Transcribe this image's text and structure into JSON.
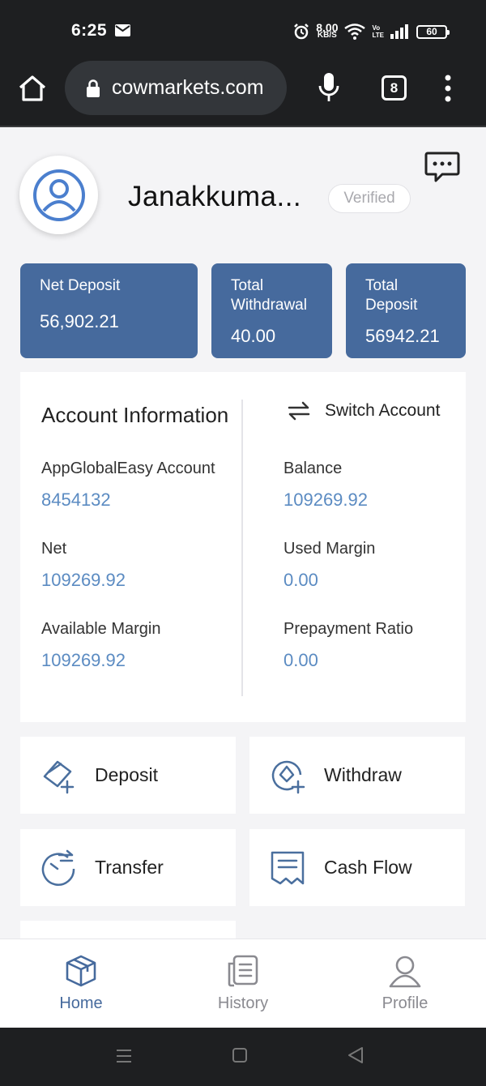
{
  "status_bar": {
    "time": "6:25",
    "net_speed_value": "8.00",
    "net_speed_unit": "KB/S",
    "network_type_top": "Vo",
    "network_type_bottom": "LTE",
    "battery_level": "60"
  },
  "browser": {
    "url": "cowmarkets.com",
    "tab_count": "8"
  },
  "profile": {
    "name": "Janakkuma...",
    "status_badge": "Verified"
  },
  "summary_cards": [
    {
      "label": "Net Deposit",
      "value": "56,902.21"
    },
    {
      "label": "Total Withdrawal",
      "value": "40.00"
    },
    {
      "label": "Total Deposit",
      "value": "56942.21"
    }
  ],
  "account_info": {
    "title": "Account Information",
    "switch_label": "Switch Account",
    "fields": [
      {
        "label": "AppGlobalEasy Account",
        "value": "8454132"
      },
      {
        "label": "Balance",
        "value": "109269.92"
      },
      {
        "label": "Net",
        "value": "109269.92"
      },
      {
        "label": "Used Margin",
        "value": "0.00"
      },
      {
        "label": "Available Margin",
        "value": "109269.92"
      },
      {
        "label": "Prepayment Ratio",
        "value": "0.00"
      }
    ]
  },
  "actions": [
    {
      "label": "Deposit",
      "icon": "deposit-card-icon"
    },
    {
      "label": "Withdraw",
      "icon": "withdraw-icon"
    },
    {
      "label": "Transfer",
      "icon": "transfer-icon"
    },
    {
      "label": "Cash Flow",
      "icon": "receipt-icon"
    }
  ],
  "bottom_nav": [
    {
      "label": "Home",
      "icon": "cube-icon",
      "active": true
    },
    {
      "label": "History",
      "icon": "document-icon",
      "active": false
    },
    {
      "label": "Profile",
      "icon": "user-icon",
      "active": false
    }
  ],
  "colors": {
    "accent": "#466a9d",
    "value_text": "#5b8bc2",
    "inactive_nav": "#8a8a90"
  }
}
